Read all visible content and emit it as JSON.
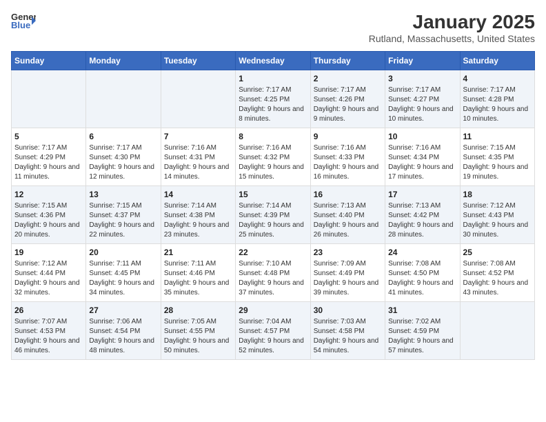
{
  "header": {
    "logo_line1": "General",
    "logo_line2": "Blue",
    "month": "January 2025",
    "location": "Rutland, Massachusetts, United States"
  },
  "weekdays": [
    "Sunday",
    "Monday",
    "Tuesday",
    "Wednesday",
    "Thursday",
    "Friday",
    "Saturday"
  ],
  "weeks": [
    [
      {
        "day": "",
        "info": ""
      },
      {
        "day": "",
        "info": ""
      },
      {
        "day": "",
        "info": ""
      },
      {
        "day": "1",
        "info": "Sunrise: 7:17 AM\nSunset: 4:25 PM\nDaylight: 9 hours and 8 minutes."
      },
      {
        "day": "2",
        "info": "Sunrise: 7:17 AM\nSunset: 4:26 PM\nDaylight: 9 hours and 9 minutes."
      },
      {
        "day": "3",
        "info": "Sunrise: 7:17 AM\nSunset: 4:27 PM\nDaylight: 9 hours and 10 minutes."
      },
      {
        "day": "4",
        "info": "Sunrise: 7:17 AM\nSunset: 4:28 PM\nDaylight: 9 hours and 10 minutes."
      }
    ],
    [
      {
        "day": "5",
        "info": "Sunrise: 7:17 AM\nSunset: 4:29 PM\nDaylight: 9 hours and 11 minutes."
      },
      {
        "day": "6",
        "info": "Sunrise: 7:17 AM\nSunset: 4:30 PM\nDaylight: 9 hours and 12 minutes."
      },
      {
        "day": "7",
        "info": "Sunrise: 7:16 AM\nSunset: 4:31 PM\nDaylight: 9 hours and 14 minutes."
      },
      {
        "day": "8",
        "info": "Sunrise: 7:16 AM\nSunset: 4:32 PM\nDaylight: 9 hours and 15 minutes."
      },
      {
        "day": "9",
        "info": "Sunrise: 7:16 AM\nSunset: 4:33 PM\nDaylight: 9 hours and 16 minutes."
      },
      {
        "day": "10",
        "info": "Sunrise: 7:16 AM\nSunset: 4:34 PM\nDaylight: 9 hours and 17 minutes."
      },
      {
        "day": "11",
        "info": "Sunrise: 7:15 AM\nSunset: 4:35 PM\nDaylight: 9 hours and 19 minutes."
      }
    ],
    [
      {
        "day": "12",
        "info": "Sunrise: 7:15 AM\nSunset: 4:36 PM\nDaylight: 9 hours and 20 minutes."
      },
      {
        "day": "13",
        "info": "Sunrise: 7:15 AM\nSunset: 4:37 PM\nDaylight: 9 hours and 22 minutes."
      },
      {
        "day": "14",
        "info": "Sunrise: 7:14 AM\nSunset: 4:38 PM\nDaylight: 9 hours and 23 minutes."
      },
      {
        "day": "15",
        "info": "Sunrise: 7:14 AM\nSunset: 4:39 PM\nDaylight: 9 hours and 25 minutes."
      },
      {
        "day": "16",
        "info": "Sunrise: 7:13 AM\nSunset: 4:40 PM\nDaylight: 9 hours and 26 minutes."
      },
      {
        "day": "17",
        "info": "Sunrise: 7:13 AM\nSunset: 4:42 PM\nDaylight: 9 hours and 28 minutes."
      },
      {
        "day": "18",
        "info": "Sunrise: 7:12 AM\nSunset: 4:43 PM\nDaylight: 9 hours and 30 minutes."
      }
    ],
    [
      {
        "day": "19",
        "info": "Sunrise: 7:12 AM\nSunset: 4:44 PM\nDaylight: 9 hours and 32 minutes."
      },
      {
        "day": "20",
        "info": "Sunrise: 7:11 AM\nSunset: 4:45 PM\nDaylight: 9 hours and 34 minutes."
      },
      {
        "day": "21",
        "info": "Sunrise: 7:11 AM\nSunset: 4:46 PM\nDaylight: 9 hours and 35 minutes."
      },
      {
        "day": "22",
        "info": "Sunrise: 7:10 AM\nSunset: 4:48 PM\nDaylight: 9 hours and 37 minutes."
      },
      {
        "day": "23",
        "info": "Sunrise: 7:09 AM\nSunset: 4:49 PM\nDaylight: 9 hours and 39 minutes."
      },
      {
        "day": "24",
        "info": "Sunrise: 7:08 AM\nSunset: 4:50 PM\nDaylight: 9 hours and 41 minutes."
      },
      {
        "day": "25",
        "info": "Sunrise: 7:08 AM\nSunset: 4:52 PM\nDaylight: 9 hours and 43 minutes."
      }
    ],
    [
      {
        "day": "26",
        "info": "Sunrise: 7:07 AM\nSunset: 4:53 PM\nDaylight: 9 hours and 46 minutes."
      },
      {
        "day": "27",
        "info": "Sunrise: 7:06 AM\nSunset: 4:54 PM\nDaylight: 9 hours and 48 minutes."
      },
      {
        "day": "28",
        "info": "Sunrise: 7:05 AM\nSunset: 4:55 PM\nDaylight: 9 hours and 50 minutes."
      },
      {
        "day": "29",
        "info": "Sunrise: 7:04 AM\nSunset: 4:57 PM\nDaylight: 9 hours and 52 minutes."
      },
      {
        "day": "30",
        "info": "Sunrise: 7:03 AM\nSunset: 4:58 PM\nDaylight: 9 hours and 54 minutes."
      },
      {
        "day": "31",
        "info": "Sunrise: 7:02 AM\nSunset: 4:59 PM\nDaylight: 9 hours and 57 minutes."
      },
      {
        "day": "",
        "info": ""
      }
    ]
  ]
}
